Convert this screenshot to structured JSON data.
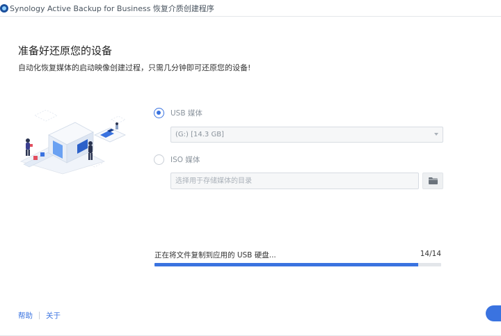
{
  "window": {
    "title": "Synology Active Backup for Business 恢复介质创建程序"
  },
  "page": {
    "heading": "准备好还原您的设备",
    "subheading": "自动化恢复媒体的启动映像创建过程，只需几分钟即可还原您的设备!"
  },
  "options": {
    "usb": {
      "label": "USB 媒体",
      "checked": true,
      "selected_drive": "(G:) [14.3 GB]"
    },
    "iso": {
      "label": "ISO 媒体",
      "checked": false,
      "path_placeholder": "选择用于存储媒体的目录"
    }
  },
  "progress": {
    "status": "正在将文件复制到应用的 USB 硬盘...",
    "count": "14/14",
    "fraction": 0.92
  },
  "footer": {
    "help_label": "帮助",
    "about_label": "关于"
  },
  "colors": {
    "accent": "#3a73e0",
    "border": "#d7dce2",
    "muted_text": "#8a939c"
  },
  "icons": {
    "app": "synology-app-icon",
    "folder": "folder-icon",
    "dropdown": "chevron-down-icon"
  }
}
